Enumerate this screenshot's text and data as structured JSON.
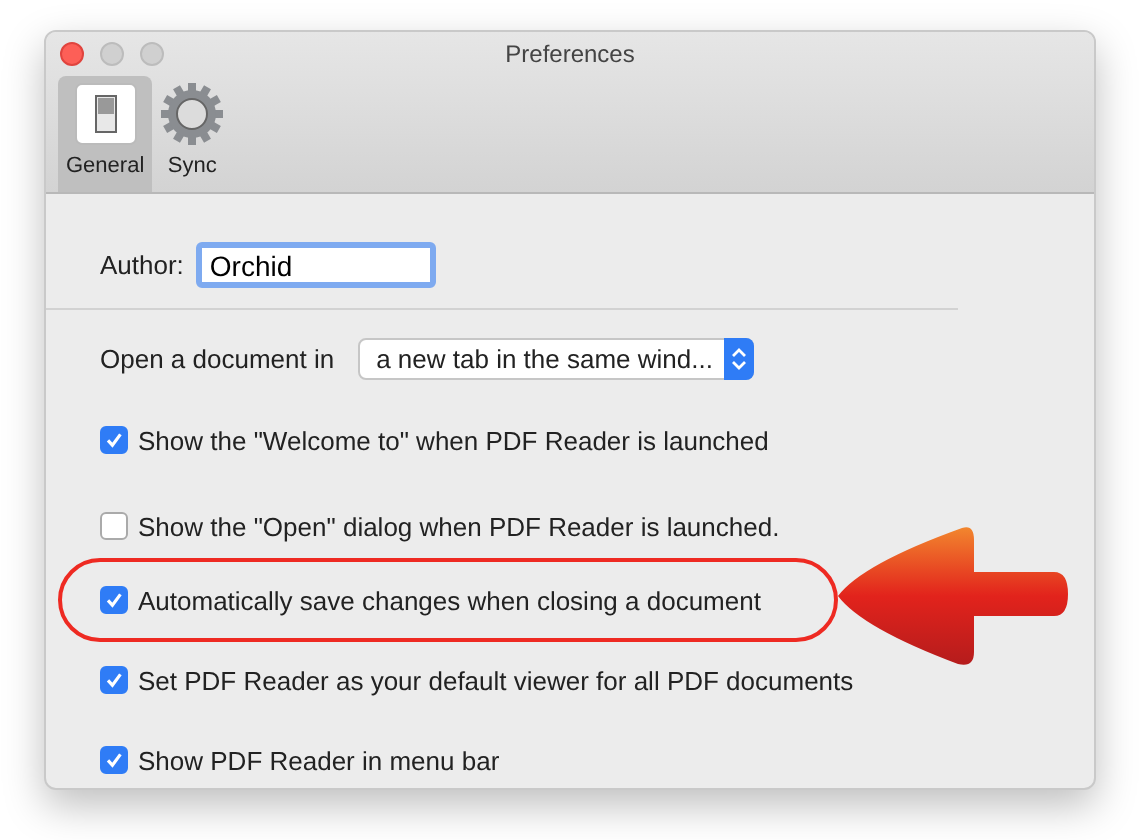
{
  "window": {
    "title": "Preferences"
  },
  "tabs": [
    {
      "label": "General",
      "kind": "general",
      "selected": true
    },
    {
      "label": "Sync",
      "kind": "sync",
      "selected": false
    }
  ],
  "author": {
    "label": "Author:",
    "value": "Orchid"
  },
  "open_in": {
    "label": "Open a document in",
    "value": "a new tab in the same wind..."
  },
  "options": [
    {
      "label": "Show the \"Welcome to\" when PDF Reader is launched",
      "checked": true,
      "highlighted": false
    },
    {
      "label": "Show the \"Open\" dialog when PDF Reader is launched.",
      "checked": false,
      "highlighted": false
    },
    {
      "label": "Automatically save changes when closing a document",
      "checked": true,
      "highlighted": true
    },
    {
      "label": "Set PDF Reader as your default viewer for all PDF documents",
      "checked": true,
      "highlighted": false
    },
    {
      "label": "Show PDF Reader in menu bar",
      "checked": true,
      "highlighted": false
    }
  ]
}
